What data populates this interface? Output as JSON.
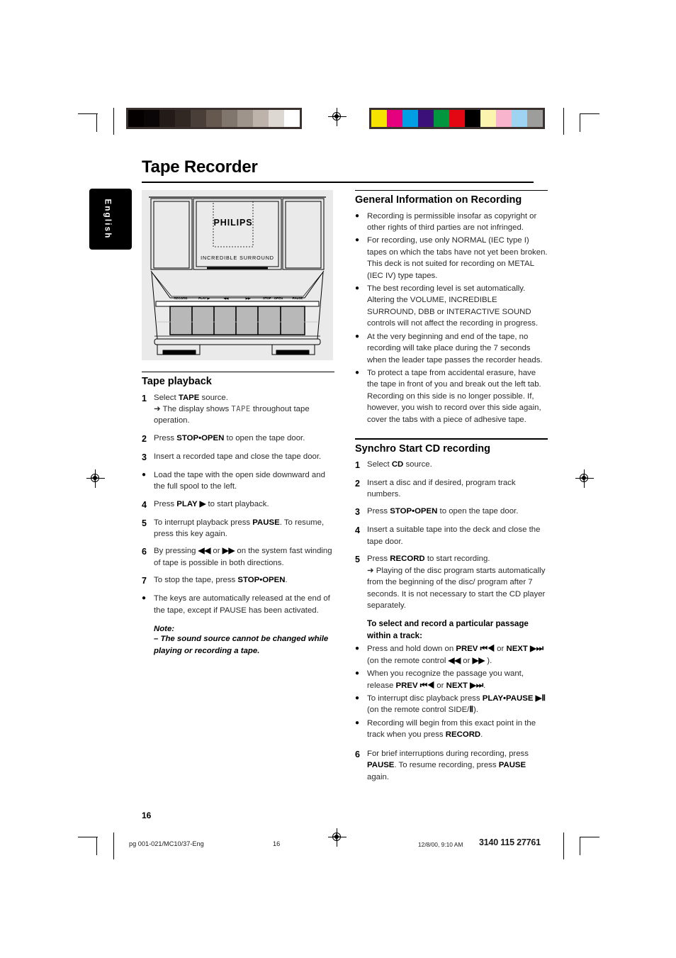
{
  "document": {
    "title": "Tape Recorder",
    "language_tab": "English",
    "page_number": "16"
  },
  "calibration": {
    "grayscale": [
      "#040000",
      "#0a0506",
      "#221b18",
      "#322823",
      "#4a3f38",
      "#65594f",
      "#81766d",
      "#9e948c",
      "#bdb3aa",
      "#ded8d2",
      "#ffffff"
    ],
    "color": [
      "#f6e400",
      "#e5007d",
      "#009fe3",
      "#3b1079",
      "#009640",
      "#e30613",
      "#000000",
      "#fbf4ae",
      "#f9b4cd",
      "#9fd3f2",
      "#9d9d9c"
    ],
    "border": "#3b322f"
  },
  "illustration": {
    "brand": "PHILIPS",
    "feature_label": "INCREDIBLE SURROUND",
    "button_labels": [
      "RECORD",
      "PLAY ▶",
      "◀◀",
      "▶▶",
      "STOP · OPEN",
      "PAUSE"
    ],
    "background": "#eaeaea"
  },
  "left_column": {
    "section_title": "Tape playback",
    "steps": [
      {
        "marker": "1",
        "type": "number",
        "parts": [
          {
            "t": "Select "
          },
          {
            "t": "TAPE",
            "b": true
          },
          {
            "t": " source."
          }
        ],
        "sublines": [
          {
            "arrow": true,
            "parts": [
              {
                "t": "The display shows "
              },
              {
                "t": "TAPE",
                "lcd": true
              },
              {
                "t": " throughout tape operation."
              }
            ]
          }
        ]
      },
      {
        "marker": "2",
        "type": "number",
        "parts": [
          {
            "t": "Press "
          },
          {
            "t": "STOP•OPEN",
            "b": true
          },
          {
            "t": " to open the tape door."
          }
        ]
      },
      {
        "marker": "3",
        "type": "number",
        "parts": [
          {
            "t": "Insert a recorded tape and close the tape door."
          }
        ]
      },
      {
        "marker": "●",
        "type": "bullet",
        "parts": [
          {
            "t": "Load the tape with the open side downward and the full spool to the left."
          }
        ]
      },
      {
        "marker": "4",
        "type": "number",
        "parts": [
          {
            "t": "Press "
          },
          {
            "t": "PLAY ▶",
            "b": true
          },
          {
            "t": " to start playback."
          }
        ]
      },
      {
        "marker": "5",
        "type": "number",
        "parts": [
          {
            "t": "To interrupt playback press "
          },
          {
            "t": "PAUSE",
            "b": true
          },
          {
            "t": ". To resume, press this key again."
          }
        ]
      },
      {
        "marker": "6",
        "type": "number",
        "parts": [
          {
            "t": "By pressing "
          },
          {
            "t": "◀◀",
            "b": true
          },
          {
            "t": " or "
          },
          {
            "t": "▶▶",
            "b": true
          },
          {
            "t": " on the system fast winding of tape is possible in both directions."
          }
        ]
      },
      {
        "marker": "7",
        "type": "number",
        "parts": [
          {
            "t": "To stop the tape, press "
          },
          {
            "t": "STOP•OPEN",
            "b": true
          },
          {
            "t": "."
          }
        ]
      },
      {
        "marker": "●",
        "type": "bullet",
        "parts": [
          {
            "t": "The keys are automatically released at the end of the tape, except if PAUSE has been activated."
          }
        ]
      }
    ],
    "note": {
      "title": "Note:",
      "body": "– The sound source cannot be changed while playing or recording a tape."
    }
  },
  "right_column": {
    "section1_title": "General Information on Recording",
    "section1_bullets": [
      "Recording is permissible insofar as copyright or other rights of third parties are not infringed.",
      "For recording, use only NORMAL (IEC type I) tapes on which the tabs have not yet been broken. This deck is not suited for recording on METAL (IEC IV) type tapes.",
      "The best recording level is set automatically. Altering the VOLUME, INCREDIBLE SURROUND, DBB or INTERACTIVE SOUND controls will not affect the recording in progress.",
      "At the very beginning and end of the tape, no recording will take place during the 7 seconds when the leader tape passes the recorder heads.",
      "To protect a tape from accidental erasure, have the tape in front of you and break out the left tab. Recording on this side is no longer possible. If, however, you wish to record over this side again, cover the tabs with a piece of adhesive tape."
    ],
    "section2_title": "Synchro Start CD recording",
    "section2_steps": [
      {
        "marker": "1",
        "type": "number",
        "parts": [
          {
            "t": "Select "
          },
          {
            "t": "CD",
            "b": true
          },
          {
            "t": " source."
          }
        ]
      },
      {
        "marker": "2",
        "type": "number",
        "parts": [
          {
            "t": "Insert a disc and if desired, program track numbers."
          }
        ]
      },
      {
        "marker": "3",
        "type": "number",
        "parts": [
          {
            "t": "Press "
          },
          {
            "t": "STOP•OPEN",
            "b": true
          },
          {
            "t": " to open the tape door."
          }
        ]
      },
      {
        "marker": "4",
        "type": "number",
        "parts": [
          {
            "t": "Insert a suitable tape into the deck and close the tape door."
          }
        ]
      },
      {
        "marker": "5",
        "type": "number",
        "parts": [
          {
            "t": "Press "
          },
          {
            "t": "RECORD",
            "b": true
          },
          {
            "t": " to start recording."
          }
        ],
        "sublines": [
          {
            "arrow": true,
            "parts": [
              {
                "t": "Playing of the disc program starts automatically from the beginning of the disc/ program  after 7 seconds. It is not necessary to start the CD player separately."
              }
            ]
          }
        ]
      }
    ],
    "subsection_title": "To select and record a particular passage within a track:",
    "subsection_bullets": [
      [
        {
          "t": "Press and hold down on "
        },
        {
          "t": "PREV ⏮◀",
          "b": true
        },
        {
          "t": " or "
        },
        {
          "t": "NEXT ▶⏭",
          "b": true
        },
        {
          "t": " (on the remote control "
        },
        {
          "t": "◀◀",
          "b": true
        },
        {
          "t": " or "
        },
        {
          "t": "▶▶",
          "b": true
        },
        {
          "t": " )."
        }
      ],
      [
        {
          "t": "When you recognize the passage you want, release "
        },
        {
          "t": "PREV ⏮◀",
          "b": true
        },
        {
          "t": " or "
        },
        {
          "t": "NEXT ▶⏭",
          "b": true
        },
        {
          "t": "."
        }
      ],
      [
        {
          "t": "To interrupt disc playback press "
        },
        {
          "t": "PLAY•PAUSE ▶Ⅱ",
          "b": true
        },
        {
          "t": " (on the remote control SIDE/"
        },
        {
          "t": "Ⅱ",
          "b": true
        },
        {
          "t": ")."
        }
      ],
      [
        {
          "t": "Recording will begin from this exact point in the track when you press "
        },
        {
          "t": "RECORD",
          "b": true
        },
        {
          "t": "."
        }
      ]
    ],
    "final_step": {
      "marker": "6",
      "type": "number",
      "parts": [
        {
          "t": "For brief interruptions during recording, press "
        },
        {
          "t": "PAUSE",
          "b": true
        },
        {
          "t": ". To resume recording, press "
        },
        {
          "t": "PAUSE",
          "b": true
        },
        {
          "t": " again."
        }
      ]
    }
  },
  "footer": {
    "file": "pg 001-021/MC10/37-Eng",
    "page": "16",
    "date": "12/8/00, 9:10 AM",
    "code": "3140 115 27761"
  }
}
